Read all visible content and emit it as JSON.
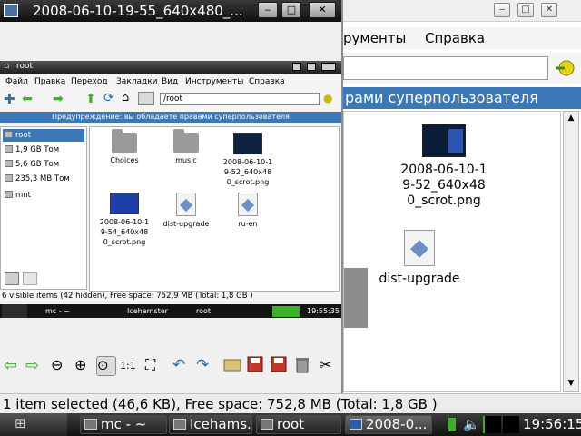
{
  "background_window": {
    "menu": [
      "рументы",
      "Справка"
    ],
    "warning": "рами суперпользователя",
    "items": [
      {
        "label": "2008-06-10-1\n9-52_640x48\n0_scrot.png",
        "kind": "thumb"
      },
      {
        "label": "dist-upgrade",
        "kind": "doc"
      }
    ],
    "status": "1 item selected (46,6 KB), Free space: 752,8 MB (Total: 1,8 GB )"
  },
  "viewer": {
    "title": "2008-06-10-19-55_640x480_..."
  },
  "shot": {
    "title": "root",
    "menu": [
      "Файл",
      "Правка",
      "Переход",
      "Закладки",
      "Вид",
      "Инструменты",
      "Справка"
    ],
    "path": "/root",
    "warning": "Предупреждение: вы обладаете правами суперпользователя",
    "sidebar": [
      "root",
      "1,9 GB Том",
      "5,6 GB Том",
      "235,3 MB Том",
      "mnt"
    ],
    "files": [
      {
        "label": "Choices",
        "kind": "folder"
      },
      {
        "label": "music",
        "kind": "folder"
      },
      {
        "label": "2008-06-10-1\n9-52_640x48\n0_scrot.png",
        "kind": "thumb"
      },
      {
        "label": "2008-06-10-1\n9-54_640x48\n0_scrot.png",
        "kind": "thumb-blue"
      },
      {
        "label": "dist-upgrade",
        "kind": "doc"
      },
      {
        "label": "ru-en",
        "kind": "doc"
      }
    ],
    "status": "6 visible items (42 hidden), Free space: 752,9 MB (Total: 1,8 GB )",
    "taskbar": {
      "mc": "mc - ~",
      "ice": "Icehamster",
      "root": "root",
      "clock": "19:55:35"
    }
  },
  "taskbar": {
    "tasks": [
      "mc - ~",
      "Icehams...",
      "root",
      "2008-0..."
    ],
    "clock": "19:56:15"
  },
  "colors": {
    "accent": "#3b78b8",
    "taskbar": "#1a1a1a",
    "green": "#3fae2a"
  }
}
